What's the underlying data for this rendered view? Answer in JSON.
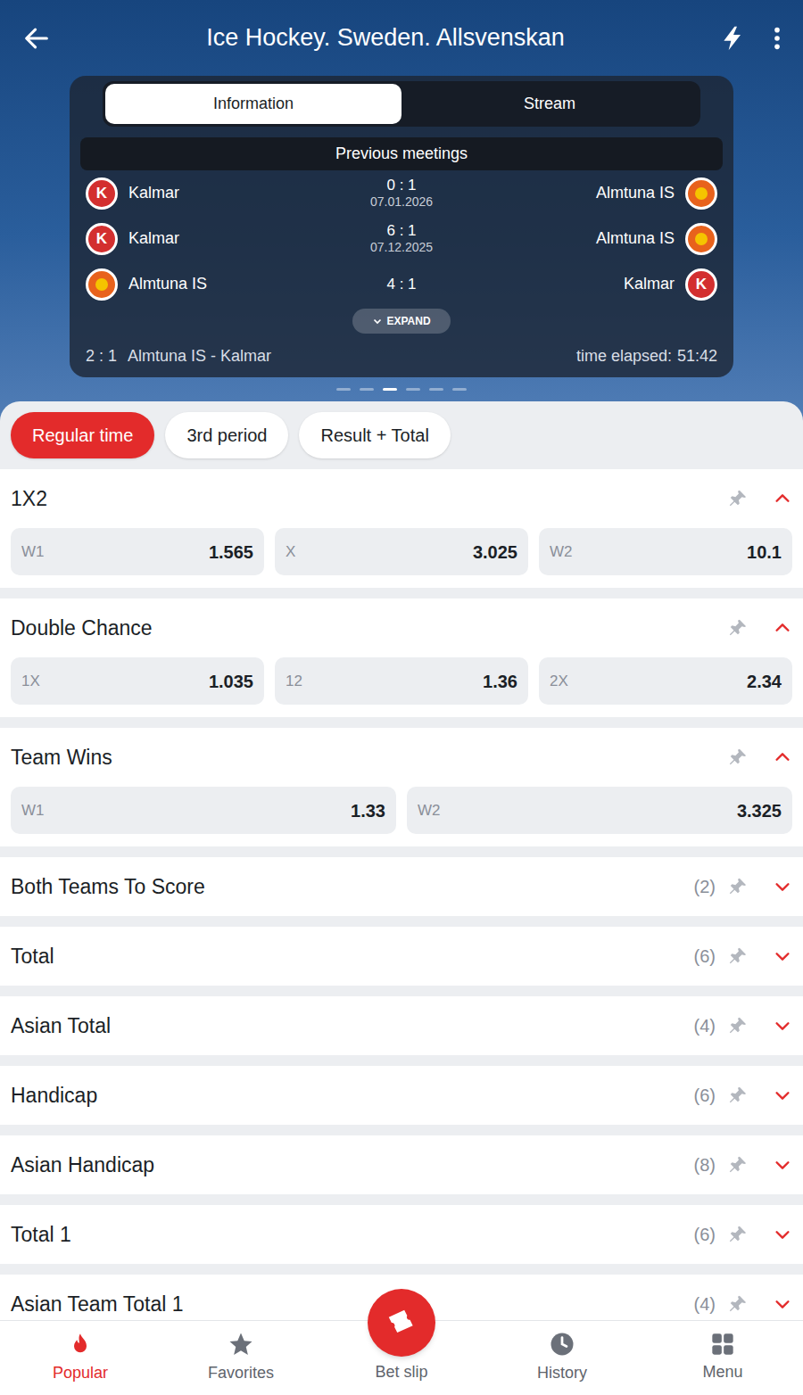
{
  "header": {
    "title": "Ice Hockey. Sweden. Allsvenskan"
  },
  "info_tabs": [
    {
      "label": "Information",
      "selected": true
    },
    {
      "label": "Stream",
      "selected": false
    }
  ],
  "teams": [
    {
      "name": "Kalmar",
      "logo_text": "K",
      "color": "#d32f2f"
    },
    {
      "name": "Almtuna IS",
      "color": "#e8621c"
    }
  ],
  "previous_meetings": {
    "title": "Previous meetings",
    "rows": [
      {
        "home": "Kalmar",
        "score": "0 : 1",
        "date": "07.01.2026",
        "away": "Almtuna IS"
      },
      {
        "home": "Kalmar",
        "score": "6 : 1",
        "date": "07.12.2025",
        "away": "Almtuna IS"
      },
      {
        "home": "Almtuna IS",
        "score": "4 : 1",
        "away": "Kalmar"
      }
    ],
    "expand": "EXPAND"
  },
  "live": {
    "score": "2 : 1",
    "teams": "Almtuna IS - Kalmar",
    "elapsed_label": "time elapsed:",
    "elapsed": "51:42"
  },
  "carousel": [
    {
      "selected": false
    },
    {
      "selected": false
    },
    {
      "selected": true
    },
    {
      "selected": false
    },
    {
      "selected": false
    },
    {
      "selected": false
    }
  ],
  "period_tabs": [
    {
      "label": "Regular time",
      "selected": true
    },
    {
      "label": "3rd period",
      "selected": false
    },
    {
      "label": "Result + Total",
      "selected": false
    }
  ],
  "markets": [
    {
      "title": "1X2",
      "expanded": true,
      "outcomes": [
        {
          "label": "W1",
          "odds": "1.565"
        },
        {
          "label": "X",
          "odds": "3.025"
        },
        {
          "label": "W2",
          "odds": "10.1"
        }
      ]
    },
    {
      "title": "Double Chance",
      "expanded": true,
      "outcomes": [
        {
          "label": "1X",
          "odds": "1.035"
        },
        {
          "label": "12",
          "odds": "1.36"
        },
        {
          "label": "2X",
          "odds": "2.34"
        }
      ]
    },
    {
      "title": "Team Wins",
      "expanded": true,
      "outcomes": [
        {
          "label": "W1",
          "odds": "1.33"
        },
        {
          "label": "W2",
          "odds": "3.325"
        }
      ]
    },
    {
      "title": "Both Teams To Score",
      "expanded": false,
      "count": "(2)"
    },
    {
      "title": "Total",
      "expanded": false,
      "count": "(6)"
    },
    {
      "title": "Asian Total",
      "expanded": false,
      "count": "(4)"
    },
    {
      "title": "Handicap",
      "expanded": false,
      "count": "(6)"
    },
    {
      "title": "Asian Handicap",
      "expanded": false,
      "count": "(8)"
    },
    {
      "title": "Total 1",
      "expanded": false,
      "count": "(6)"
    },
    {
      "title": "Asian Team Total 1",
      "expanded": false,
      "count": "(4)"
    }
  ],
  "nav": [
    {
      "label": "Popular",
      "selected": true,
      "kind": "tab"
    },
    {
      "label": "Favorites",
      "selected": false,
      "kind": "tab"
    },
    {
      "label": "Bet slip",
      "selected": false,
      "kind": "center"
    },
    {
      "label": "History",
      "selected": false,
      "kind": "tab"
    },
    {
      "label": "Menu",
      "selected": false,
      "kind": "tab"
    }
  ]
}
